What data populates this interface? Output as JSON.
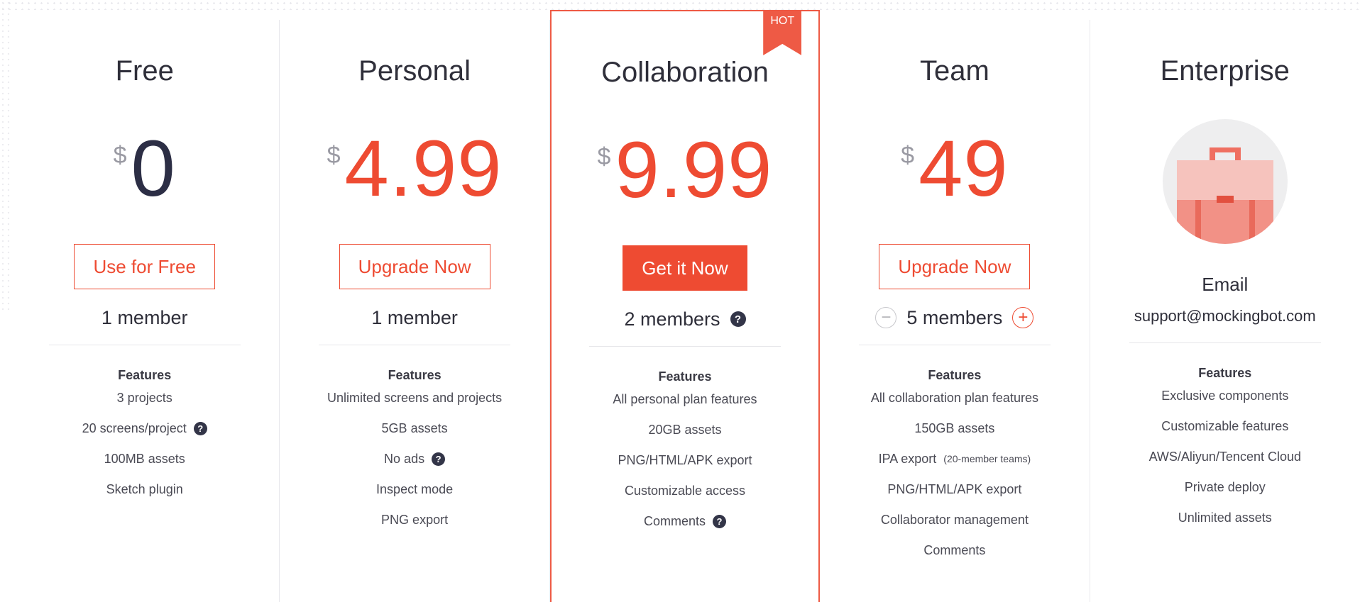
{
  "plans": [
    {
      "name": "Free",
      "currency": "$",
      "price": "0",
      "cta": "Use for Free",
      "members": "1 member",
      "features_title": "Features",
      "features": [
        "3 projects",
        "20 screens/project",
        "100MB assets",
        "Sketch plugin"
      ]
    },
    {
      "name": "Personal",
      "currency": "$",
      "price": "4.99",
      "cta": "Upgrade Now",
      "members": "1 member",
      "features_title": "Features",
      "features": [
        "Unlimited screens and projects",
        "5GB assets",
        "No ads",
        "Inspect mode",
        "PNG export"
      ]
    },
    {
      "name": "Collaboration",
      "badge": "HOT",
      "currency": "$",
      "price": "9.99",
      "cta": "Get it Now",
      "members": "2 members",
      "features_title": "Features",
      "features": [
        "All personal plan features",
        "20GB assets",
        "PNG/HTML/APK export",
        "Customizable access",
        "Comments"
      ]
    },
    {
      "name": "Team",
      "currency": "$",
      "price": "49",
      "cta": "Upgrade Now",
      "members": "5 members",
      "features_title": "Features",
      "features": [
        "All collaboration plan features",
        "150GB assets",
        "IPA export",
        "PNG/HTML/APK export",
        "Collaborator management",
        "Comments"
      ],
      "ipa_note": "(20-member teams)"
    },
    {
      "name": "Enterprise",
      "email_label": "Email",
      "email": "support@mockingbot.com",
      "features_title": "Features",
      "features": [
        "Exclusive components",
        "Customizable features",
        "AWS/Aliyun/Tencent Cloud",
        "Private deploy",
        "Unlimited assets"
      ]
    }
  ],
  "icons": {
    "help": "question-circle-icon",
    "minus": "minus-circle-icon",
    "plus": "plus-circle-icon",
    "briefcase": "briefcase-icon",
    "help_glyph": "?",
    "minus_glyph": "−",
    "plus_glyph": "+"
  },
  "colors": {
    "accent": "#ee4b32",
    "dark_price": "#2c2e45",
    "help_icon": "#333548"
  }
}
